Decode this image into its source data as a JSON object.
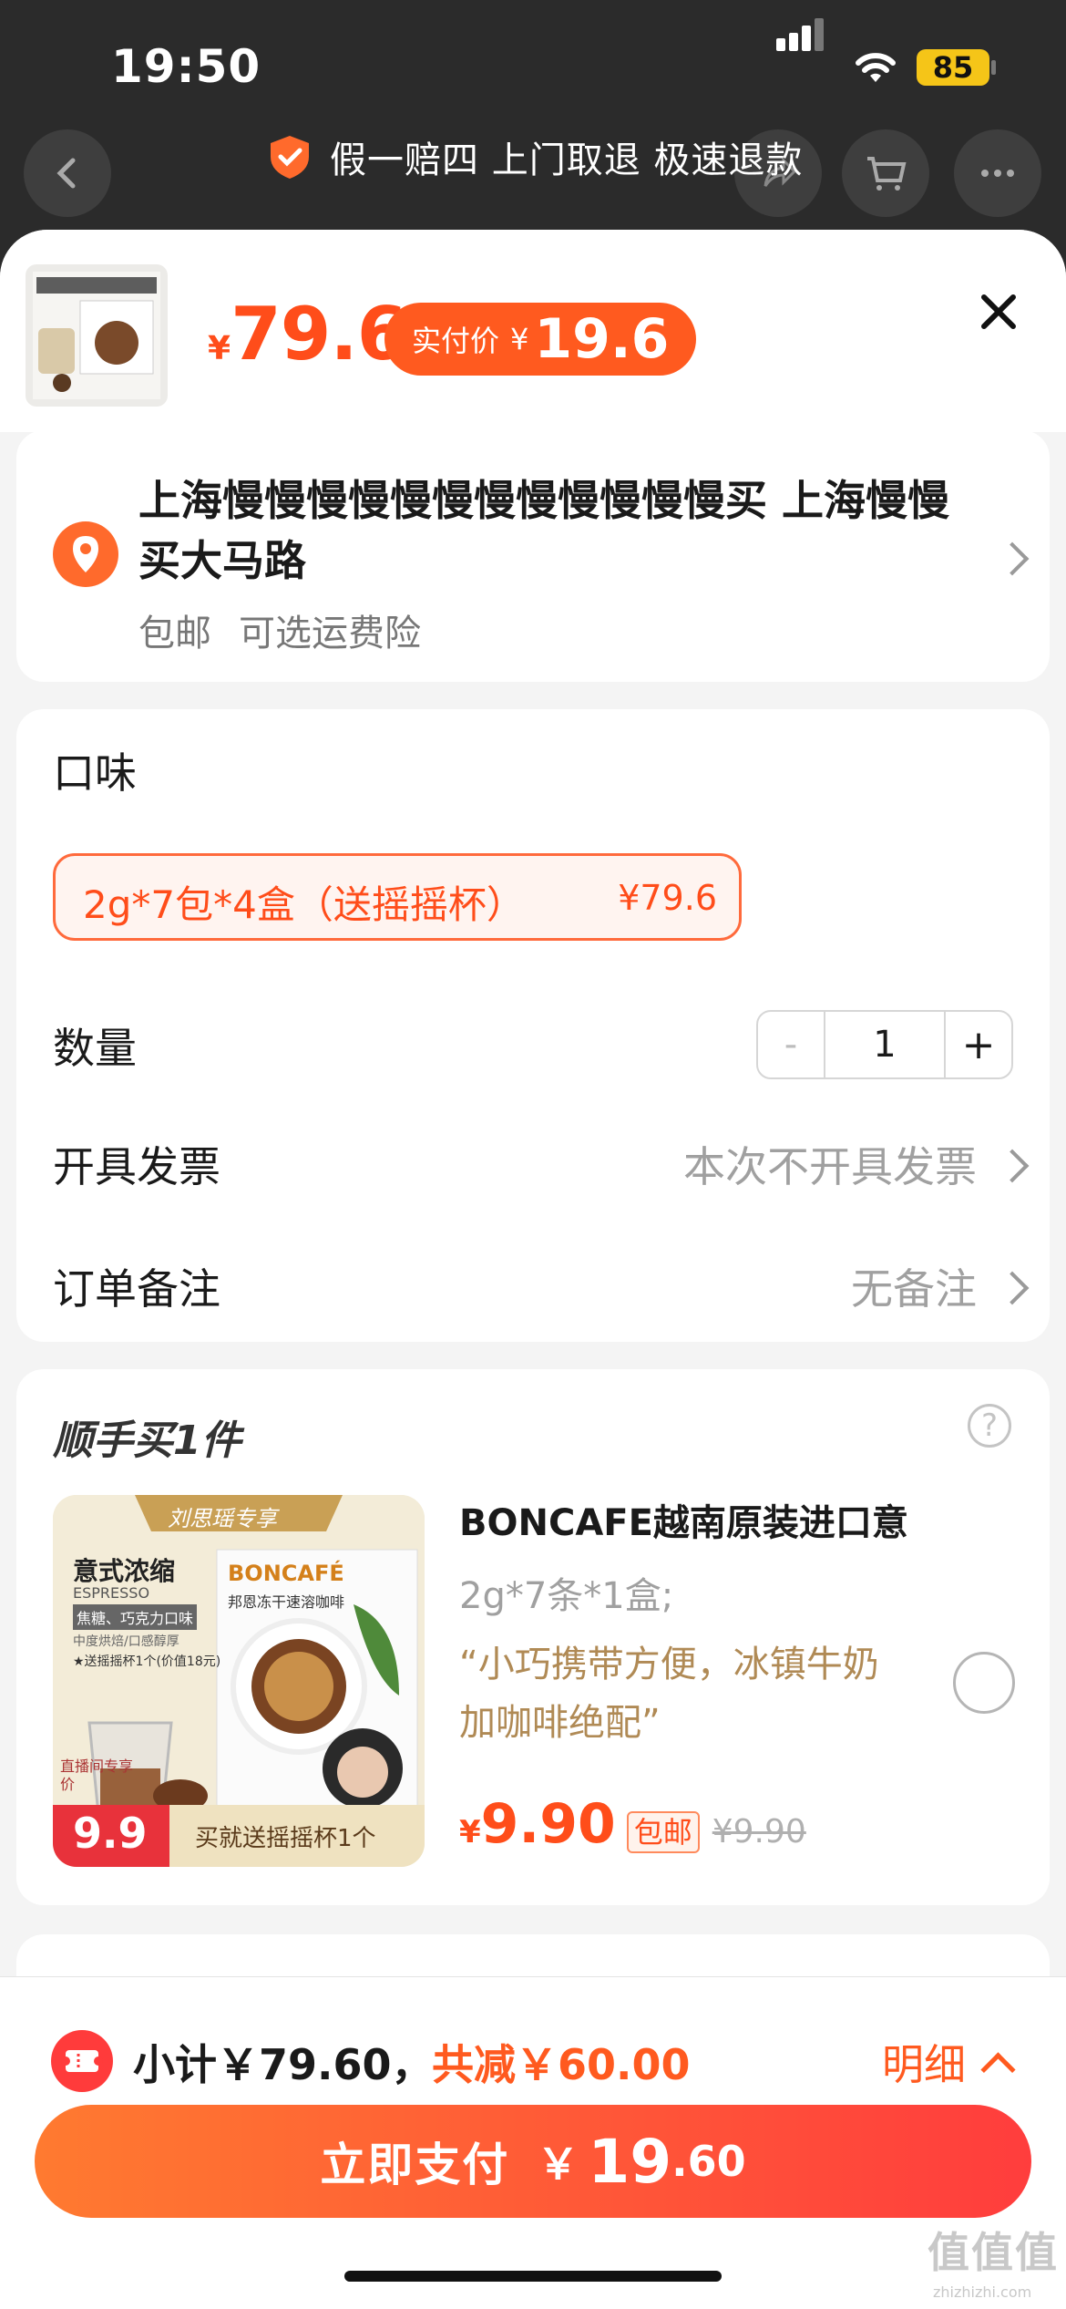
{
  "status_bar": {
    "time": "19:50",
    "battery": "85"
  },
  "header": {
    "guarantee": "假一赔四 上门取退 极速退款"
  },
  "product": {
    "currency": "¥",
    "price": "79.6",
    "pay_label": "实付价",
    "pay_price": "19.6"
  },
  "address": {
    "line": "上海慢慢慢慢慢慢慢慢慢慢慢慢买 上海慢慢买大马路",
    "shipping": "包邮",
    "insurance": "可选运费险"
  },
  "options": {
    "flavor_label": "口味",
    "flavor_name": "2g*7包*4盒（送摇摇杯）",
    "flavor_price": "¥79.6",
    "qty_label": "数量",
    "qty_minus": "-",
    "qty_value": "1",
    "qty_plus": "+",
    "invoice_label": "开具发票",
    "invoice_value": "本次不开具发票",
    "note_label": "订单备注",
    "note_value": "无备注"
  },
  "addon": {
    "title": "顺手买1件",
    "image_text": {
      "tag": "刘思瑶专享",
      "line1": "意式浓缩",
      "line2": "ESPRESSO",
      "line3": "焦糖、巧克力口味",
      "line4": "中度烘焙/口感醇厚",
      "line5": "★送摇摇杯1个(价值18元)",
      "brand": "BONCAFÉ",
      "box_sub": "邦恩冻干速溶咖啡",
      "live": "直播间专享价",
      "price": "9.9",
      "gift": "买就送摇摇杯1个"
    },
    "name": "BONCAFE越南原装进口意",
    "spec": "2g*7条*1盒;",
    "quote": "“小巧携带方便，冰镇牛奶加咖啡绝配”",
    "currency": "¥",
    "price": "9.90",
    "tag": "包邮",
    "original": "¥9.90"
  },
  "bottom": {
    "subtotal": "小计￥79.60，",
    "discount": "共减￥60.00",
    "detail": "明细",
    "pay_label": "立即支付",
    "pay_currency": "￥",
    "pay_int": "19",
    "pay_dec": ".60",
    "watermark": "值值值",
    "watermark_url": "zhizhizhi.com"
  },
  "colors": {
    "accent": "#ff5a1f",
    "price": "#ff4d1a",
    "background": "#f4f4f4"
  }
}
